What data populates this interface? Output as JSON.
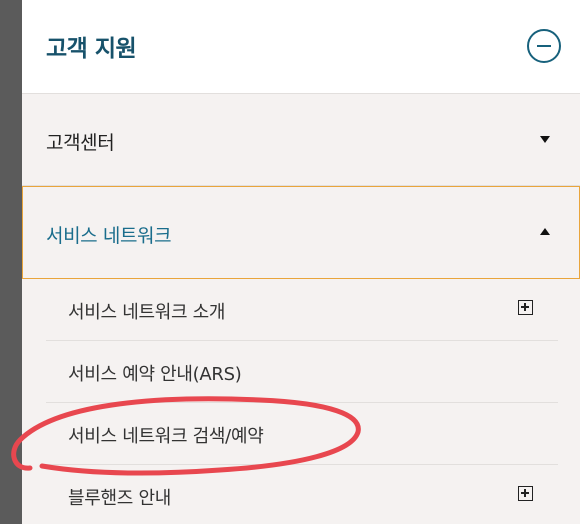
{
  "header": {
    "title": "고객 지원"
  },
  "menu": {
    "customer_center": {
      "label": "고객센터",
      "expanded": false
    },
    "service_network": {
      "label": "서비스 네트워크",
      "expanded": true,
      "items": [
        {
          "label": "서비스 네트워크 소개",
          "icon": "plus-box-icon"
        },
        {
          "label": "서비스 예약 안내(ARS)"
        },
        {
          "label": "서비스 네트워크 검색/예약",
          "highlighted": true
        },
        {
          "label": "블루핸즈 안내",
          "icon": "plus-box-icon"
        }
      ]
    }
  },
  "colors": {
    "title": "#17526b",
    "active_label": "#1a6d8c",
    "active_border": "#e9a53c",
    "annotation": "#e8474f",
    "panel_bg": "#f5f2f1"
  }
}
